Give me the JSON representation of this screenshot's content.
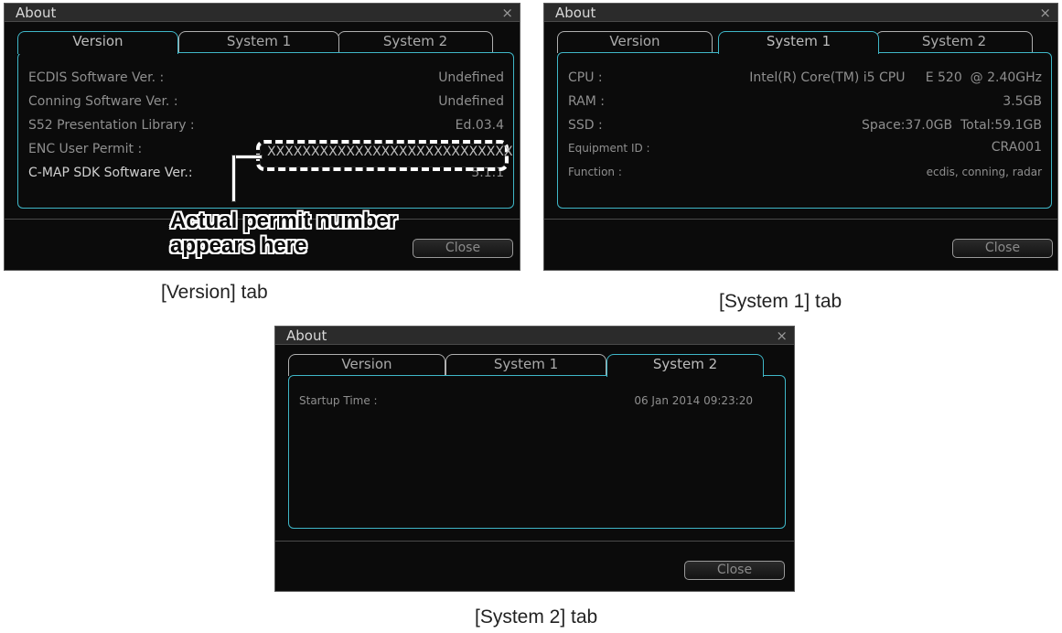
{
  "dialogs": {
    "version": {
      "title": "About",
      "close_glyph": "×",
      "tabs": [
        "Version",
        "System 1",
        "System 2"
      ],
      "active_tab": "Version",
      "rows": [
        {
          "label": "ECDIS Software Ver. :",
          "value": "Undefined"
        },
        {
          "label": "Conning Software Ver. :",
          "value": "Undefined"
        },
        {
          "label": "S52 Presentation Library :",
          "value": "Ed.03.4"
        },
        {
          "label": "ENC User Permit :",
          "value": "XXXXXXXXXXXXXXXXXXXXXXXXXXXX"
        },
        {
          "label": "C-MAP SDK Software Ver.:",
          "value": "5.1.1"
        }
      ],
      "close_label": "Close"
    },
    "system1": {
      "title": "About",
      "close_glyph": "×",
      "tabs": [
        "Version",
        "System 1",
        "System 2"
      ],
      "active_tab": "System 1",
      "rows": [
        {
          "label": "CPU :",
          "value": "Intel(R) Core(TM) i5 CPU     E 520  @ 2.40GHz"
        },
        {
          "label": "RAM :",
          "value": "3.5GB"
        },
        {
          "label": "SSD :",
          "value": "Space:37.0GB  Total:59.1GB"
        },
        {
          "label": "Equipment ID :",
          "value": "CRA001"
        },
        {
          "label": "Function :",
          "value": "ecdis, conning, radar"
        }
      ],
      "close_label": "Close"
    },
    "system2": {
      "title": "About",
      "close_glyph": "×",
      "tabs": [
        "Version",
        "System 1",
        "System 2"
      ],
      "active_tab": "System 2",
      "rows": [
        {
          "label": "Startup Time :",
          "value": "06 Jan 2014 09:23:20"
        }
      ],
      "close_label": "Close"
    }
  },
  "callout": {
    "line1": "Actual permit number",
    "line2": "appears here"
  },
  "captions": {
    "version": "[Version] tab",
    "system1": "[System 1] tab",
    "system2": "[System 2] tab"
  },
  "colors": {
    "dialog_bg": "#0b0b0b",
    "accent": "#3fb7c8",
    "text": "#8f8f8f"
  }
}
